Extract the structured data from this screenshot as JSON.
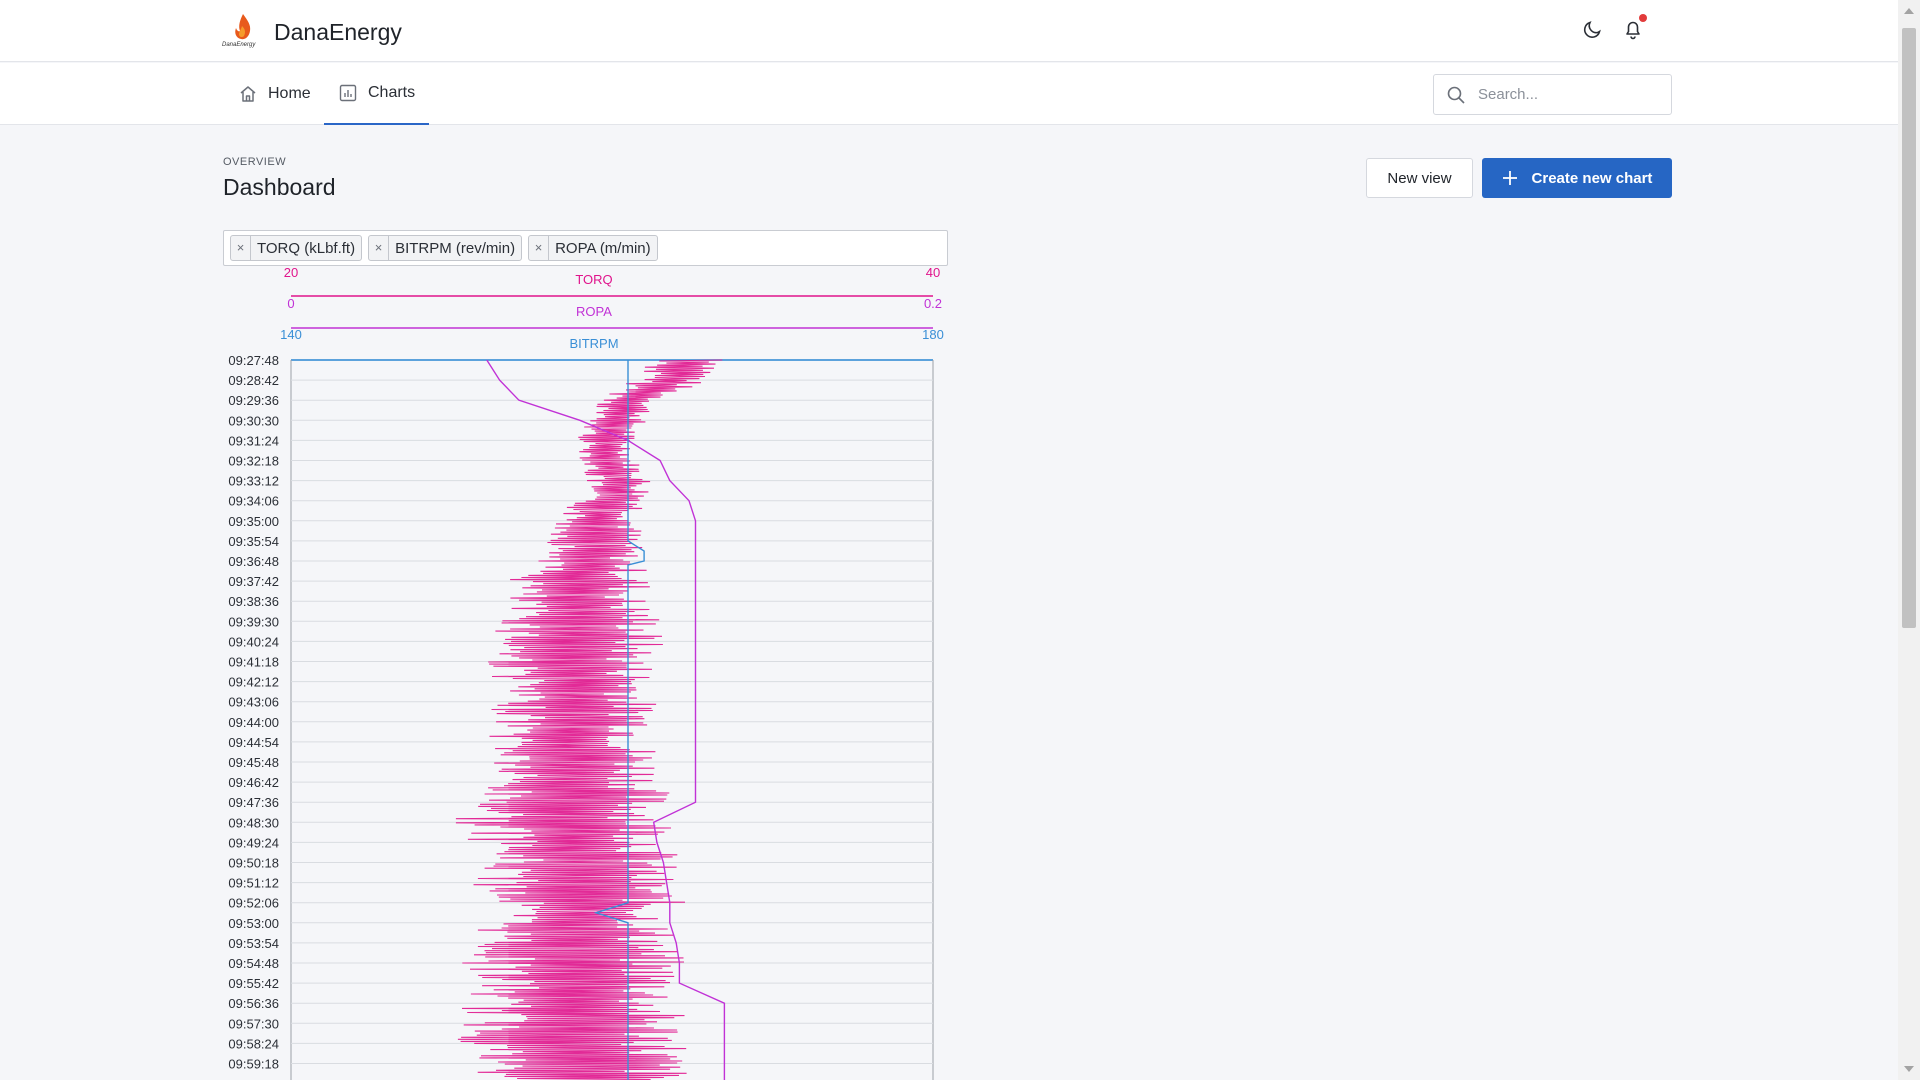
{
  "app": {
    "name": "DanaEnergy",
    "logo_text": "DanaEnergy"
  },
  "icons": {
    "theme": "moon-icon",
    "notifications": "bell-icon",
    "home": "home-icon",
    "charts": "bar-chart-icon",
    "search": "search-icon",
    "add": "plus-icon",
    "remove": "close-icon"
  },
  "nav": {
    "tabs": [
      {
        "label": "Home",
        "active": false
      },
      {
        "label": "Charts",
        "active": true
      }
    ]
  },
  "search": {
    "placeholder": "Search..."
  },
  "header": {
    "eyebrow": "OVERVIEW",
    "title": "Dashboard",
    "new_view_label": "New view",
    "create_label": "Create new chart"
  },
  "filters": {
    "tags": [
      {
        "label": "TORQ (kLbf.ft)",
        "remove": "×"
      },
      {
        "label": "BITRPM (rev/min)",
        "remove": "×"
      },
      {
        "label": "ROPA (m/min)",
        "remove": "×"
      }
    ]
  },
  "colors": {
    "accent": "#2666c4",
    "torq": "#e0148c",
    "ropa": "#c132d6",
    "bitrpm": "#3a8fd6",
    "notification": "#e23b3b"
  },
  "chart_data": {
    "type": "line",
    "orientation": "vertical-time",
    "axes": [
      {
        "name": "TORQ",
        "range": [
          20,
          40
        ],
        "min_label": "20",
        "max_label": "40",
        "color": "#e0148c"
      },
      {
        "name": "ROPA",
        "range": [
          0,
          0.2
        ],
        "min_label": "0",
        "max_label": "0.2",
        "color": "#c132d6"
      },
      {
        "name": "BITRPM",
        "range": [
          140,
          180
        ],
        "min_label": "140",
        "max_label": "180",
        "color": "#3a8fd6"
      }
    ],
    "time_ticks": [
      "09:27:48",
      "09:28:42",
      "09:29:36",
      "09:30:30",
      "09:31:24",
      "09:32:18",
      "09:33:12",
      "09:34:06",
      "09:35:00",
      "09:35:54",
      "09:36:48",
      "09:37:42",
      "09:38:36",
      "09:39:30",
      "09:40:24",
      "09:41:18",
      "09:42:12",
      "09:43:06",
      "09:44:00",
      "09:44:54",
      "09:45:48",
      "09:46:42",
      "09:47:36",
      "09:48:30",
      "09:49:24",
      "09:50:18",
      "09:51:12",
      "09:52:06",
      "09:53:00",
      "09:53:54",
      "09:54:48",
      "09:55:42",
      "09:56:36",
      "09:57:30",
      "09:58:24",
      "09:59:18"
    ],
    "series": [
      {
        "name": "TORQ",
        "points": [
          [
            0,
            32.5
          ],
          [
            1,
            31.8
          ],
          [
            2,
            30.6
          ],
          [
            3,
            30.1
          ],
          [
            4,
            29.8
          ],
          [
            5,
            29.9
          ],
          [
            6,
            30.2
          ],
          [
            7,
            30.0
          ],
          [
            8,
            29.6
          ],
          [
            9,
            29.5
          ],
          [
            10,
            29.3
          ],
          [
            11,
            29.0
          ],
          [
            12,
            28.8
          ],
          [
            13,
            29.1
          ],
          [
            14,
            28.9
          ],
          [
            15,
            28.7
          ],
          [
            16,
            28.9
          ],
          [
            17,
            28.8
          ],
          [
            18,
            29.0
          ],
          [
            19,
            28.7
          ],
          [
            20,
            28.9
          ],
          [
            21,
            28.8
          ],
          [
            22,
            28.7
          ],
          [
            23,
            28.6
          ],
          [
            24,
            28.9
          ],
          [
            25,
            29.0
          ],
          [
            26,
            28.8
          ],
          [
            27,
            29.2
          ],
          [
            28,
            28.9
          ],
          [
            29,
            28.9
          ],
          [
            30,
            28.8
          ],
          [
            31,
            29.0
          ],
          [
            32,
            28.7
          ],
          [
            33,
            28.8
          ],
          [
            34,
            28.9
          ],
          [
            35,
            28.9
          ]
        ],
        "band": [
          [
            0,
            1.4
          ],
          [
            1,
            1.2
          ],
          [
            2,
            1.0
          ],
          [
            3,
            1.0
          ],
          [
            4,
            0.9
          ],
          [
            5,
            0.9
          ],
          [
            6,
            1.1
          ],
          [
            7,
            1.3
          ],
          [
            8,
            1.4
          ],
          [
            9,
            1.5
          ],
          [
            10,
            1.6
          ],
          [
            11,
            2.4
          ],
          [
            12,
            2.4
          ],
          [
            13,
            2.6
          ],
          [
            14,
            2.8
          ],
          [
            15,
            2.7
          ],
          [
            16,
            2.6
          ],
          [
            17,
            2.6
          ],
          [
            18,
            2.7
          ],
          [
            19,
            2.7
          ],
          [
            20,
            2.8
          ],
          [
            21,
            3.0
          ],
          [
            22,
            3.2
          ],
          [
            23,
            3.6
          ],
          [
            24,
            3.3
          ],
          [
            25,
            3.1
          ],
          [
            26,
            3.2
          ],
          [
            27,
            3.1
          ],
          [
            28,
            3.1
          ],
          [
            29,
            3.3
          ],
          [
            30,
            3.5
          ],
          [
            31,
            3.4
          ],
          [
            32,
            3.5
          ],
          [
            33,
            3.6
          ],
          [
            34,
            3.8
          ],
          [
            35,
            3.6
          ]
        ]
      },
      {
        "name": "ROPA",
        "points": [
          [
            0,
            0.061
          ],
          [
            1,
            0.065
          ],
          [
            2,
            0.071
          ],
          [
            3,
            0.09
          ],
          [
            4,
            0.105
          ],
          [
            5,
            0.115
          ],
          [
            6,
            0.118
          ],
          [
            7,
            0.124
          ],
          [
            8,
            0.126
          ],
          [
            9,
            0.126
          ],
          [
            10,
            0.126
          ],
          [
            11,
            0.126
          ],
          [
            12,
            0.126
          ],
          [
            13,
            0.126
          ],
          [
            14,
            0.126
          ],
          [
            15,
            0.126
          ],
          [
            16,
            0.126
          ],
          [
            17,
            0.126
          ],
          [
            18,
            0.126
          ],
          [
            19,
            0.126
          ],
          [
            20,
            0.126
          ],
          [
            21,
            0.126
          ],
          [
            22,
            0.126
          ],
          [
            23,
            0.113
          ],
          [
            24,
            0.114
          ],
          [
            25,
            0.116
          ],
          [
            26,
            0.117
          ],
          [
            27,
            0.118
          ],
          [
            28,
            0.118
          ],
          [
            29,
            0.12
          ],
          [
            30,
            0.121
          ],
          [
            31,
            0.121
          ],
          [
            32,
            0.135
          ],
          [
            33,
            0.135
          ],
          [
            34,
            0.135
          ],
          [
            35,
            0.135
          ]
        ]
      },
      {
        "name": "BITRPM",
        "points": [
          [
            0,
            161
          ],
          [
            5,
            161
          ],
          [
            9,
            161
          ],
          [
            9.5,
            162
          ],
          [
            10,
            162
          ],
          [
            10.2,
            161
          ],
          [
            27,
            161
          ],
          [
            27.5,
            159
          ],
          [
            28,
            161
          ],
          [
            35,
            161
          ]
        ]
      }
    ],
    "grid": true
  }
}
